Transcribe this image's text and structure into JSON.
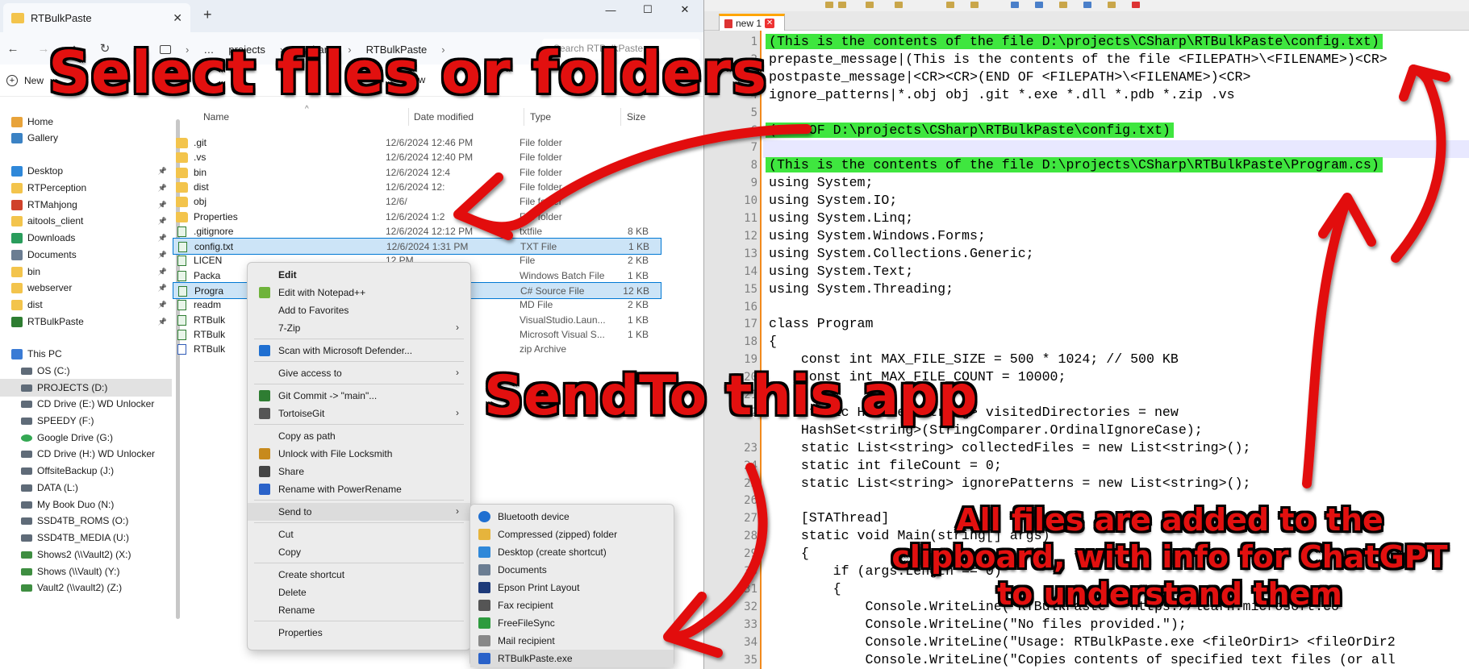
{
  "explorer": {
    "tab_title": "RTBulkPaste",
    "tab_close": "✕",
    "new_tab": "+",
    "window_controls": [
      "—",
      "☐",
      "✕"
    ],
    "breadcrumb": [
      "…",
      "projects",
      "CSharp",
      "RTBulkPaste"
    ],
    "search_placeholder": "Search RTBulkPaste",
    "new_button": "New",
    "view_partial": "ew",
    "columns": {
      "name": "Name",
      "date": "Date modified",
      "type": "Type",
      "size": "Size"
    },
    "sidebar": [
      {
        "label": "Home",
        "icon": "home-icon"
      },
      {
        "label": "Gallery",
        "icon": "gallery-icon"
      },
      {
        "label": "Desktop",
        "icon": "desktop-icon",
        "pinned": true
      },
      {
        "label": "RTPerception",
        "icon": "folder-icon",
        "pinned": true
      },
      {
        "label": "RTMahjong",
        "icon": "app-icon",
        "pinned": true
      },
      {
        "label": "aitools_client",
        "icon": "folder-icon",
        "pinned": true
      },
      {
        "label": "Downloads",
        "icon": "download-icon",
        "pinned": true
      },
      {
        "label": "Documents",
        "icon": "documents-icon",
        "pinned": true
      },
      {
        "label": "bin",
        "icon": "folder-icon",
        "pinned": true
      },
      {
        "label": "webserver",
        "icon": "folder-icon",
        "pinned": true
      },
      {
        "label": "dist",
        "icon": "folder-icon",
        "pinned": true
      },
      {
        "label": "RTBulkPaste",
        "icon": "git-folder-icon",
        "pinned": true
      },
      {
        "label": "This PC",
        "icon": "pc-icon"
      },
      {
        "label": "OS (C:)",
        "icon": "drive-icon"
      },
      {
        "label": "PROJECTS (D:)",
        "icon": "drive-icon"
      },
      {
        "label": "CD Drive (E:) WD Unlocker",
        "icon": "cd-drive-icon"
      },
      {
        "label": "SPEEDY (F:)",
        "icon": "drive-icon"
      },
      {
        "label": "Google Drive (G:)",
        "icon": "google-drive-icon"
      },
      {
        "label": "CD Drive (H:) WD Unlocker",
        "icon": "cd-drive-icon"
      },
      {
        "label": "OffsiteBackup (J:)",
        "icon": "drive-icon"
      },
      {
        "label": "DATA (L:)",
        "icon": "drive-icon"
      },
      {
        "label": "My Book Duo (N:)",
        "icon": "drive-icon"
      },
      {
        "label": "SSD4TB_ROMS (O:)",
        "icon": "drive-icon"
      },
      {
        "label": "SSD4TB_MEDIA (U:)",
        "icon": "drive-icon"
      },
      {
        "label": "Shows2 (\\\\Vault2) (X:)",
        "icon": "network-drive-icon"
      },
      {
        "label": "Shows (\\\\Vault) (Y:)",
        "icon": "network-drive-icon"
      },
      {
        "label": "Vault2 (\\\\vault2) (Z:)",
        "icon": "network-drive-icon"
      }
    ],
    "files": [
      {
        "name": ".git",
        "date": "12/6/2024 12:46 PM",
        "type": "File folder",
        "size": "",
        "kind": "folder"
      },
      {
        "name": ".vs",
        "date": "12/6/2024 12:40 PM",
        "type": "File folder",
        "size": "",
        "kind": "folder"
      },
      {
        "name": "bin",
        "date": "12/6/2024 12:4",
        "type": "File folder",
        "size": "",
        "kind": "folder"
      },
      {
        "name": "dist",
        "date": "12/6/2024 12:",
        "type": "File folder",
        "size": "",
        "kind": "folder"
      },
      {
        "name": "obj",
        "date": "12/6/",
        "type": "File folder",
        "size": "",
        "kind": "folder"
      },
      {
        "name": "Properties",
        "date": "12/6/2024 1:2",
        "type": "File folder",
        "size": "",
        "kind": "folder"
      },
      {
        "name": ".gitignore",
        "date": "12/6/2024 12:12 PM",
        "type": "txtfile",
        "size": "8 KB",
        "kind": "git"
      },
      {
        "name": "config.txt",
        "date": "12/6/2024 1:31 PM",
        "type": "TXT File",
        "size": "1 KB",
        "kind": "git",
        "selected": true
      },
      {
        "name": "LICEN",
        "date": "12 PM",
        "type": "File",
        "size": "2 KB",
        "kind": "git"
      },
      {
        "name": "Packa",
        "date": "07 PM",
        "type": "Windows Batch File",
        "size": "1 KB",
        "kind": "git"
      },
      {
        "name": "Progra",
        "date": "5 PM",
        "type": "C# Source File",
        "size": "12 KB",
        "kind": "git",
        "selected": true
      },
      {
        "name": "readm",
        "date": "5 PM",
        "type": "MD File",
        "size": "2 KB",
        "kind": "git"
      },
      {
        "name": "RTBulk",
        "date": "39 AM",
        "type": "VisualStudio.Laun...",
        "size": "1 KB",
        "kind": "git"
      },
      {
        "name": "RTBulk",
        "date": "32 AM",
        "type": "Microsoft Visual S...",
        "size": "1 KB",
        "kind": "git"
      },
      {
        "name": "RTBulk",
        "date": "1 PM",
        "type": "zip Archive",
        "size": "",
        "kind": "zip"
      }
    ]
  },
  "context_menu": {
    "items": [
      {
        "label": "Edit",
        "bold": true
      },
      {
        "label": "Edit with Notepad++",
        "icon": "notepadpp-icon"
      },
      {
        "label": "Add to Favorites"
      },
      {
        "label": "7-Zip",
        "submenu": true
      },
      {
        "sep": true
      },
      {
        "label": "Scan with Microsoft Defender...",
        "icon": "defender-icon"
      },
      {
        "sep": true
      },
      {
        "label": "Give access to",
        "submenu": true
      },
      {
        "sep": true
      },
      {
        "label": "Git Commit -> \"main\"...",
        "icon": "git-commit-icon"
      },
      {
        "label": "TortoiseGit",
        "icon": "tortoisegit-icon",
        "submenu": true
      },
      {
        "sep": true
      },
      {
        "label": "Copy as path"
      },
      {
        "label": "Unlock with File Locksmith",
        "icon": "lock-icon"
      },
      {
        "label": "Share",
        "icon": "share-icon"
      },
      {
        "label": "Rename with PowerRename",
        "icon": "powerrename-icon"
      },
      {
        "sep": true
      },
      {
        "label": "Send to",
        "submenu": true,
        "highlight": true
      },
      {
        "sep": true
      },
      {
        "label": "Cut"
      },
      {
        "label": "Copy"
      },
      {
        "sep": true
      },
      {
        "label": "Create shortcut"
      },
      {
        "label": "Delete"
      },
      {
        "label": "Rename"
      },
      {
        "sep": true
      },
      {
        "label": "Properties"
      }
    ]
  },
  "sendto_menu": {
    "items": [
      {
        "label": "Bluetooth device",
        "icon": "bluetooth-icon"
      },
      {
        "label": "Compressed (zipped) folder",
        "icon": "zip-folder-icon"
      },
      {
        "label": "Desktop (create shortcut)",
        "icon": "desktop-icon"
      },
      {
        "label": "Documents",
        "icon": "documents-icon"
      },
      {
        "label": "Epson Print Layout",
        "icon": "printer-icon"
      },
      {
        "label": "Fax recipient",
        "icon": "fax-icon"
      },
      {
        "label": "FreeFileSync",
        "icon": "sync-icon"
      },
      {
        "label": "Mail recipient",
        "icon": "mail-icon"
      },
      {
        "label": "RTBulkPaste.exe",
        "icon": "app-icon",
        "highlight": true
      }
    ]
  },
  "notepad": {
    "tab_label": "new 1",
    "tab_close": "✕",
    "lines": [
      {
        "n": "1",
        "text": "(This is the contents of the file D:\\projects\\CSharp\\RTBulkPaste\\config.txt)",
        "green": true
      },
      {
        "n": "2",
        "text": "prepaste_message|(This is the contents of the file <FILEPATH>\\<FILENAME>)<CR>"
      },
      {
        "n": "3",
        "text": "postpaste_message|<CR><CR>(END OF <FILEPATH>\\<FILENAME>)<CR>"
      },
      {
        "n": "4",
        "text": "ignore_patterns|*.obj obj .git *.exe *.dll *.pdb *.zip .vs"
      },
      {
        "n": "5",
        "text": ""
      },
      {
        "n": "6",
        "text": "(END OF D:\\projects\\CSharp\\RTBulkPaste\\config.txt)",
        "green": true
      },
      {
        "n": "7",
        "text": "",
        "current": true
      },
      {
        "n": "8",
        "text": "(This is the contents of the file D:\\projects\\CSharp\\RTBulkPaste\\Program.cs)",
        "green": true
      },
      {
        "n": "9",
        "text": "using System;"
      },
      {
        "n": "10",
        "text": "using System.IO;"
      },
      {
        "n": "11",
        "text": "using System.Linq;"
      },
      {
        "n": "12",
        "text": "using System.Windows.Forms;"
      },
      {
        "n": "13",
        "text": "using System.Collections.Generic;"
      },
      {
        "n": "14",
        "text": "using System.Text;"
      },
      {
        "n": "15",
        "text": "using System.Threading;"
      },
      {
        "n": "16",
        "text": ""
      },
      {
        "n": "17",
        "text": "class Program"
      },
      {
        "n": "18",
        "text": "{"
      },
      {
        "n": "19",
        "text": "    const int MAX_FILE_SIZE = 500 * 1024; // 500 KB"
      },
      {
        "n": "20",
        "text": "    const int MAX_FILE_COUNT = 10000;"
      },
      {
        "n": "21",
        "text": ""
      },
      {
        "n": "22",
        "text": "    static HashSet<string> visitedDirectories = new"
      },
      {
        "n": "",
        "text": "    HashSet<string>(StringComparer.OrdinalIgnoreCase);"
      },
      {
        "n": "23",
        "text": "    static List<string> collectedFiles = new List<string>();"
      },
      {
        "n": "24",
        "text": "    static int fileCount = 0;"
      },
      {
        "n": "25",
        "text": "    static List<string> ignorePatterns = new List<string>();"
      },
      {
        "n": "26",
        "text": ""
      },
      {
        "n": "27",
        "text": "    [STAThread]"
      },
      {
        "n": "28",
        "text": "    static void Main(string[] args)"
      },
      {
        "n": "29",
        "text": "    {"
      },
      {
        "n": "30",
        "text": "        if (args.Length == 0)"
      },
      {
        "n": "31",
        "text": "        {"
      },
      {
        "n": "32",
        "text": "            Console.WriteLine(\"RTBulkPaste - https://learn.microsoft.co"
      },
      {
        "n": "33",
        "text": "            Console.WriteLine(\"No files provided.\");"
      },
      {
        "n": "34",
        "text": "            Console.WriteLine(\"Usage: RTBulkPaste.exe <fileOrDir1> <fileOrDir2"
      },
      {
        "n": "35",
        "text": "            Console.WriteLine(\"Copies contents of specified text files (or all"
      }
    ]
  },
  "annotations": {
    "caption_select": "Select files or folders",
    "caption_sendto": "SendTo this app",
    "caption_clipboard": "All files are added to the clipboard, with info for ChatGPT to understand them",
    "color": "#e2100f"
  }
}
